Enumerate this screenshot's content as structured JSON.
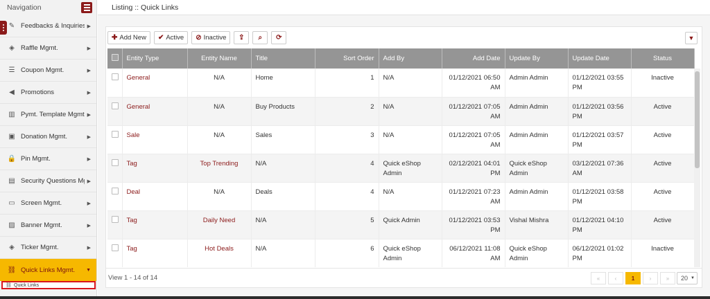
{
  "sidebar": {
    "title": "Navigation",
    "items": [
      {
        "label": "Feedbacks & Inquiries",
        "icon": "pen-square-icon",
        "glyph": "✎"
      },
      {
        "label": "Raffle Mgmt.",
        "icon": "ticket-icon",
        "glyph": "◈"
      },
      {
        "label": "Coupon Mgmt.",
        "icon": "list-icon",
        "glyph": "☰"
      },
      {
        "label": "Promotions",
        "icon": "megaphone-icon",
        "glyph": "◀"
      },
      {
        "label": "Pymt. Template Mgmt.",
        "icon": "barcode-icon",
        "glyph": "▥"
      },
      {
        "label": "Donation Mgmt.",
        "icon": "money-icon",
        "glyph": "▣"
      },
      {
        "label": "Pin Mgmt.",
        "icon": "lock-icon",
        "glyph": "🔒"
      },
      {
        "label": "Security Questions Mgmt.",
        "icon": "document-icon",
        "glyph": "▤"
      },
      {
        "label": "Screen Mgmt.",
        "icon": "monitor-icon",
        "glyph": "▭"
      },
      {
        "label": "Banner Mgmt.",
        "icon": "image-icon",
        "glyph": "▨"
      },
      {
        "label": "Ticker Mgmt.",
        "icon": "ticket-icon",
        "glyph": "◈"
      },
      {
        "label": "Quick Links Mgmt.",
        "icon": "link-icon",
        "glyph": "⛓"
      }
    ],
    "sub_item": "Quick Links"
  },
  "header": {
    "title": "Listing :: Quick Links"
  },
  "toolbar": {
    "add_new": "Add New",
    "active": "Active",
    "inactive": "Inactive"
  },
  "table": {
    "columns": [
      "Entity Type",
      "Entity Name",
      "Title",
      "Sort Order",
      "Add By",
      "Add Date",
      "Update By",
      "Update Date",
      "Status"
    ],
    "rows": [
      {
        "entity_type": "General",
        "entity_name": "N/A",
        "title": "Home",
        "sort_order": "1",
        "add_by": "N/A",
        "add_date": "01/12/2021 06:50 AM",
        "update_by": "Admin Admin",
        "update_date": "01/12/2021 03:55 PM",
        "status": "Inactive"
      },
      {
        "entity_type": "General",
        "entity_name": "N/A",
        "title": "Buy Products",
        "sort_order": "2",
        "add_by": "N/A",
        "add_date": "01/12/2021 07:05 AM",
        "update_by": "Admin Admin",
        "update_date": "01/12/2021 03:56 PM",
        "status": "Active"
      },
      {
        "entity_type": "Sale",
        "entity_name": "N/A",
        "title": "Sales",
        "sort_order": "3",
        "add_by": "N/A",
        "add_date": "01/12/2021 07:05 AM",
        "update_by": "Admin Admin",
        "update_date": "01/12/2021 03:57 PM",
        "status": "Active"
      },
      {
        "entity_type": "Tag",
        "entity_name": "Top Trending",
        "title": "N/A",
        "sort_order": "4",
        "add_by": "Quick eShop Admin",
        "add_date": "02/12/2021 04:01 PM",
        "update_by": "Quick eShop Admin",
        "update_date": "03/12/2021 07:36 AM",
        "status": "Active"
      },
      {
        "entity_type": "Deal",
        "entity_name": "N/A",
        "title": "Deals",
        "sort_order": "4",
        "add_by": "N/A",
        "add_date": "01/12/2021 07:23 AM",
        "update_by": "Admin Admin",
        "update_date": "01/12/2021 03:58 PM",
        "status": "Active"
      },
      {
        "entity_type": "Tag",
        "entity_name": "Daily Need",
        "title": "N/A",
        "sort_order": "5",
        "add_by": "Quick Admin",
        "add_date": "01/12/2021 03:53 PM",
        "update_by": "Vishal Mishra",
        "update_date": "01/12/2021 04:10 PM",
        "status": "Active"
      },
      {
        "entity_type": "Tag",
        "entity_name": "Hot Deals",
        "title": "N/A",
        "sort_order": "6",
        "add_by": "Quick eShop Admin",
        "add_date": "06/12/2021 11:08 AM",
        "update_by": "Quick eShop Admin",
        "update_date": "06/12/2021 01:02 PM",
        "status": "Inactive"
      }
    ]
  },
  "footer": {
    "view_text": "View 1 - 14 of 14",
    "pager": {
      "first": "«",
      "prev": "‹",
      "current": "1",
      "next": "›",
      "last": "»"
    },
    "page_size": "20"
  },
  "colors": {
    "accent": "#8b1a1a",
    "active_nav": "#f6b800",
    "header_bg": "#959595"
  }
}
